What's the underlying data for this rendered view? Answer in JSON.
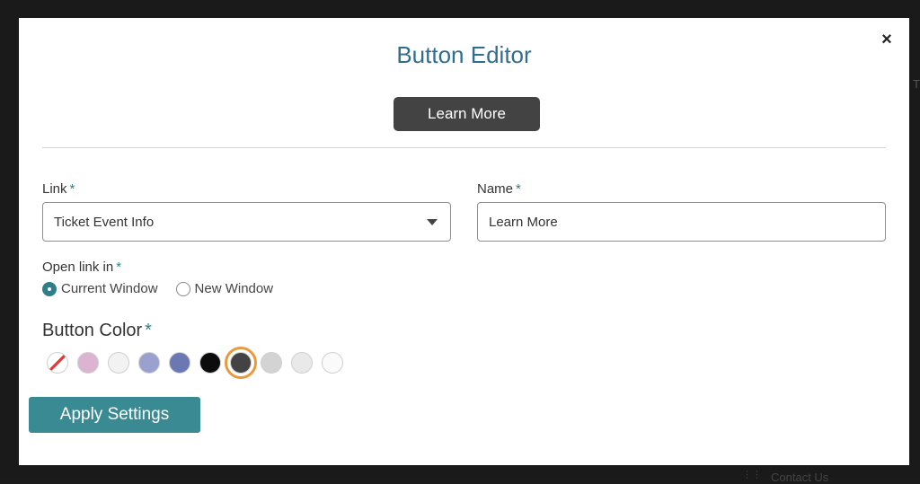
{
  "background": {
    "partial_text_right": "T",
    "footer_dots": "⋮⋮",
    "footer_link": "Contact Us"
  },
  "modal": {
    "title": "Button Editor",
    "close_label": "×",
    "preview_button_label": "Learn More",
    "link": {
      "label": "Link",
      "required_mark": "*",
      "selected_value": "Ticket Event Info"
    },
    "name": {
      "label": "Name",
      "required_mark": "*",
      "value": "Learn More"
    },
    "open_link_in": {
      "label": "Open link in",
      "required_mark": "*",
      "options": [
        {
          "label": "Current Window",
          "checked": true
        },
        {
          "label": "New Window",
          "checked": false
        }
      ]
    },
    "button_color": {
      "label": "Button Color",
      "required_mark": "*",
      "swatches": [
        {
          "color": "none"
        },
        {
          "color": "#dcb4d2"
        },
        {
          "color": "#f2f2f2"
        },
        {
          "color": "#9aa1cf"
        },
        {
          "color": "#6b78b3"
        },
        {
          "color": "#0c0c0c"
        },
        {
          "color": "#434343",
          "selected": true
        },
        {
          "color": "#d3d3d3"
        },
        {
          "color": "#e9e9e9"
        },
        {
          "color": "#fafafa"
        }
      ]
    },
    "apply_button_label": "Apply Settings"
  },
  "colors": {
    "title": "#2f6e8f",
    "accent": "#3a8a93",
    "preview_button": "#434343",
    "selected_ring": "#e99a3e"
  }
}
